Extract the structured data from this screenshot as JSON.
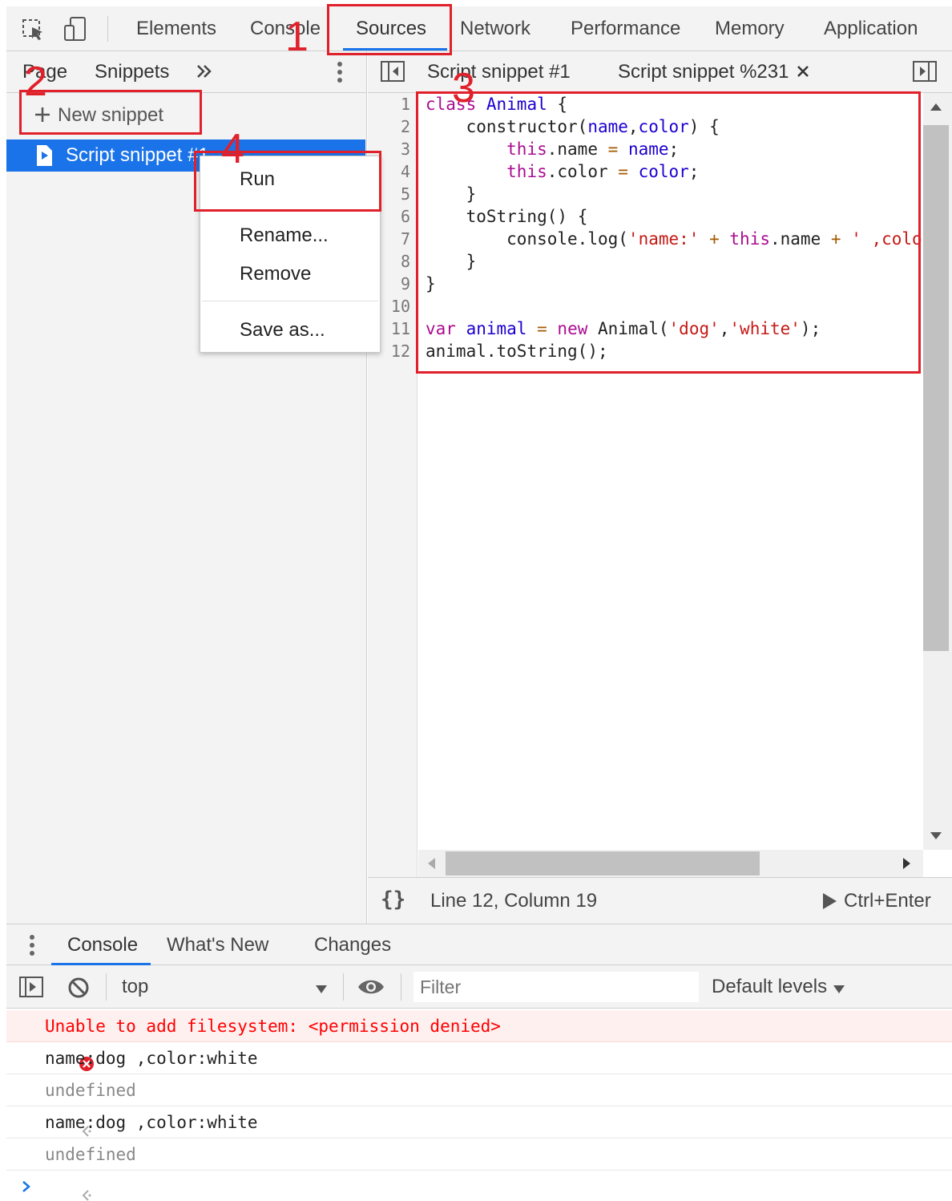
{
  "top_tabs": [
    "Elements",
    "Console",
    "Sources",
    "Network",
    "Performance",
    "Memory",
    "Application"
  ],
  "active_top_tab": "Sources",
  "navigator": {
    "tabs": [
      "Page",
      "Snippets"
    ],
    "more_tabs_icon": "double-chevron-icon",
    "new_snippet_label": "New snippet",
    "snippet_item": "Script snippet #1"
  },
  "editor": {
    "tabs": [
      {
        "label": "Script snippet #1",
        "closable": false
      },
      {
        "label": "Script snippet %231",
        "closable": true
      }
    ],
    "line_numbers": [
      "1",
      "2",
      "3",
      "4",
      "5",
      "6",
      "7",
      "8",
      "9",
      "10",
      "11",
      "12"
    ],
    "code_lines": [
      "class Animal {",
      "    constructor(name,color) {",
      "        this.name = name;",
      "        this.color = color;",
      "    }",
      "    toString() {",
      "        console.log('name:' + this.name + ' ,color:' + this.color);",
      "    }",
      "}",
      "",
      "var animal = new Animal('dog','white');",
      "animal.toString();"
    ],
    "status_position": "Line 12, Column 19",
    "run_shortcut": "Ctrl+Enter",
    "pretty_print_icon": "{}"
  },
  "context_menu": {
    "items": [
      "Run",
      "Rename...",
      "Remove",
      "Save as..."
    ]
  },
  "drawer": {
    "tabs": [
      "Console",
      "What's New",
      "Changes"
    ],
    "active_tab": "Console"
  },
  "console_toolbar": {
    "context": "top",
    "filter_placeholder": "Filter",
    "levels": "Default levels"
  },
  "console_messages": [
    {
      "type": "error",
      "text": "Unable to add filesystem: <permission denied>"
    },
    {
      "type": "log",
      "text": "name:dog ,color:white"
    },
    {
      "type": "result",
      "text": "undefined"
    },
    {
      "type": "log",
      "text": "name:dog ,color:white"
    },
    {
      "type": "result",
      "text": "undefined"
    }
  ],
  "annotations": [
    "1",
    "2",
    "3",
    "4"
  ],
  "colors": {
    "accent": "#1a73e8",
    "annotation": "#e0202a",
    "error_text": "#ff0000",
    "error_bg": "#fff0f0",
    "keyword": "#aa0d91",
    "string": "#c41a16"
  }
}
